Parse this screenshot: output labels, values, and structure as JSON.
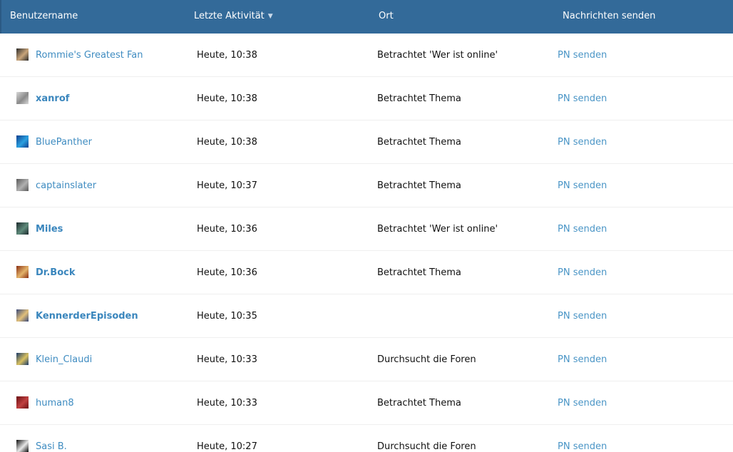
{
  "header": {
    "username": "Benutzername",
    "last_activity": "Letzte Aktivität",
    "sort_icon": "sort-desc-icon",
    "location": "Ort",
    "send_messages": "Nachrichten senden"
  },
  "rows": [
    {
      "username": "Rommie's Greatest Fan",
      "bold": false,
      "time": "Heute, 10:38",
      "location": "Betrachtet 'Wer ist online'",
      "pm": "PN senden",
      "avatar_colors": [
        "#2b2b2b",
        "#c9a57a"
      ]
    },
    {
      "username": "xanrof",
      "bold": true,
      "time": "Heute, 10:38",
      "location": "Betrachtet Thema",
      "pm": "PN senden",
      "avatar_colors": [
        "#d8d8d8",
        "#8a8a8a"
      ]
    },
    {
      "username": "BluePanther",
      "bold": false,
      "time": "Heute, 10:38",
      "location": "Betrachtet Thema",
      "pm": "PN senden",
      "avatar_colors": [
        "#0f3f8f",
        "#2aa0e0"
      ]
    },
    {
      "username": "captainslater",
      "bold": false,
      "time": "Heute, 10:37",
      "location": "Betrachtet Thema",
      "pm": "PN senden",
      "avatar_colors": [
        "#5a5a5a",
        "#b0b0b0"
      ]
    },
    {
      "username": "Miles",
      "bold": true,
      "time": "Heute, 10:36",
      "location": "Betrachtet 'Wer ist online'",
      "pm": "PN senden",
      "avatar_colors": [
        "#1d2a2e",
        "#5e8a7a"
      ]
    },
    {
      "username": "Dr.Bock",
      "bold": true,
      "time": "Heute, 10:36",
      "location": "Betrachtet Thema",
      "pm": "PN senden",
      "avatar_colors": [
        "#8a2f12",
        "#e3b36a"
      ]
    },
    {
      "username": "KennerderEpisoden",
      "bold": true,
      "time": "Heute, 10:35",
      "location": "",
      "pm": "PN senden",
      "avatar_colors": [
        "#3a4a7a",
        "#e2c07a"
      ]
    },
    {
      "username": "Klein_Claudi",
      "bold": false,
      "time": "Heute, 10:33",
      "location": "Durchsucht die Foren",
      "pm": "PN senden",
      "avatar_colors": [
        "#1a3a6a",
        "#d8c060"
      ]
    },
    {
      "username": "human8",
      "bold": false,
      "time": "Heute, 10:33",
      "location": "Betrachtet Thema",
      "pm": "PN senden",
      "avatar_colors": [
        "#6a0f12",
        "#c04040"
      ]
    },
    {
      "username": "Sasi B.",
      "bold": false,
      "time": "Heute, 10:27",
      "location": "Durchsucht die Foren",
      "pm": "PN senden",
      "avatar_colors": [
        "#0d0d0d",
        "#e8e8e8"
      ]
    }
  ]
}
